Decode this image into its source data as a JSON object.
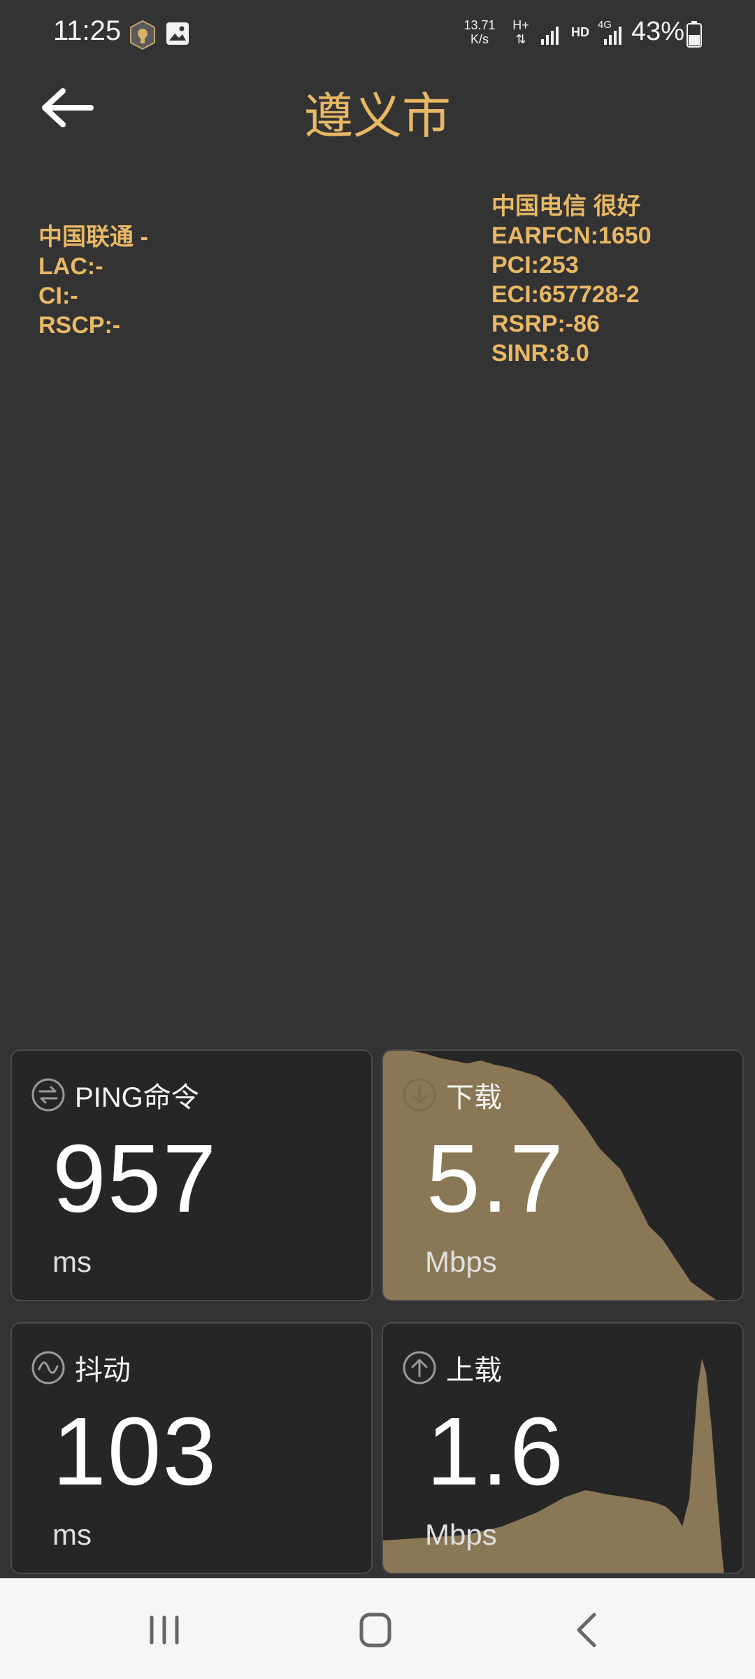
{
  "status_bar": {
    "time": "11:25",
    "net_speed_value": "13.71",
    "net_speed_unit": "K/s",
    "net_type": "H+",
    "hd_label": "HD",
    "lte_label": "4G",
    "battery_percent": "43%"
  },
  "header": {
    "title": "遵义市"
  },
  "cell_left": {
    "operator": "中国联通 -",
    "lac": "LAC:-",
    "ci": "CI:-",
    "rscp": "RSCP:-"
  },
  "cell_right": {
    "operator": "中国电信 很好",
    "earfcn": "EARFCN:1650",
    "pci": "PCI:253",
    "eci": "ECI:657728-2",
    "rsrp": "RSRP:-86",
    "sinr": "SINR:8.0"
  },
  "metrics": {
    "ping": {
      "label": "PING命令",
      "value": "957",
      "unit": "ms"
    },
    "download": {
      "label": "下载",
      "value": "5.7",
      "unit": "Mbps"
    },
    "jitter": {
      "label": "抖动",
      "value": "103",
      "unit": "ms"
    },
    "upload": {
      "label": "上载",
      "value": "1.6",
      "unit": "Mbps"
    }
  },
  "colors": {
    "accent": "#e8b865",
    "chart_fill": "#8a7755",
    "card_bg": "#262626",
    "page_bg": "#333333"
  },
  "nav": {
    "icons": [
      "recent-apps-icon",
      "home-icon",
      "back-icon"
    ]
  }
}
